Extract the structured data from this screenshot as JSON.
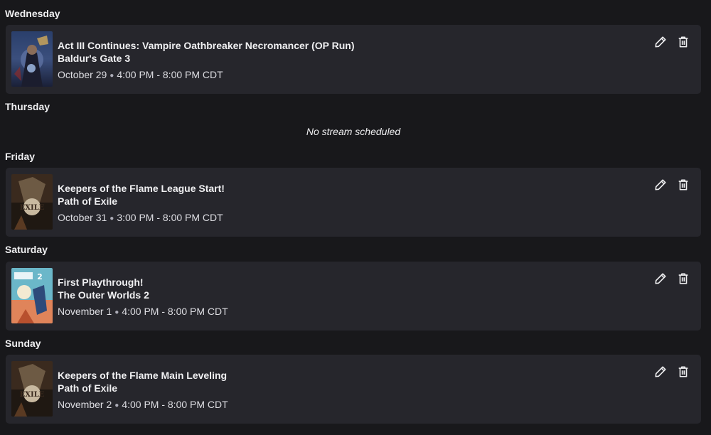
{
  "days": [
    {
      "name": "Wednesday",
      "stream": {
        "title": "Act III Continues: Vampire Oathbreaker Necromancer (OP Run)",
        "game": "Baldur's Gate 3",
        "date": "October 29",
        "time": "4:00 PM - 8:00 PM CDT",
        "cover": "baldurs-gate-3"
      }
    },
    {
      "name": "Thursday",
      "empty_text": "No stream scheduled"
    },
    {
      "name": "Friday",
      "stream": {
        "title": "Keepers of the Flame League Start!",
        "game": "Path of Exile",
        "date": "October 31",
        "time": "3:00 PM - 8:00 PM CDT",
        "cover": "path-of-exile"
      }
    },
    {
      "name": "Saturday",
      "stream": {
        "title": "First Playthrough!",
        "game": "The Outer Worlds 2",
        "date": "November 1",
        "time": "4:00 PM - 8:00 PM CDT",
        "cover": "the-outer-worlds-2"
      }
    },
    {
      "name": "Sunday",
      "stream": {
        "title": "Keepers of the Flame Main Leveling",
        "game": "Path of Exile",
        "date": "November 2",
        "time": "4:00 PM - 8:00 PM CDT",
        "cover": "path-of-exile"
      }
    }
  ],
  "icons": {
    "edit": "pencil-icon",
    "delete": "trash-icon",
    "separator": "bullet"
  },
  "colors": {
    "background": "#18181b",
    "card": "#26262c",
    "text": "#efeff1"
  }
}
